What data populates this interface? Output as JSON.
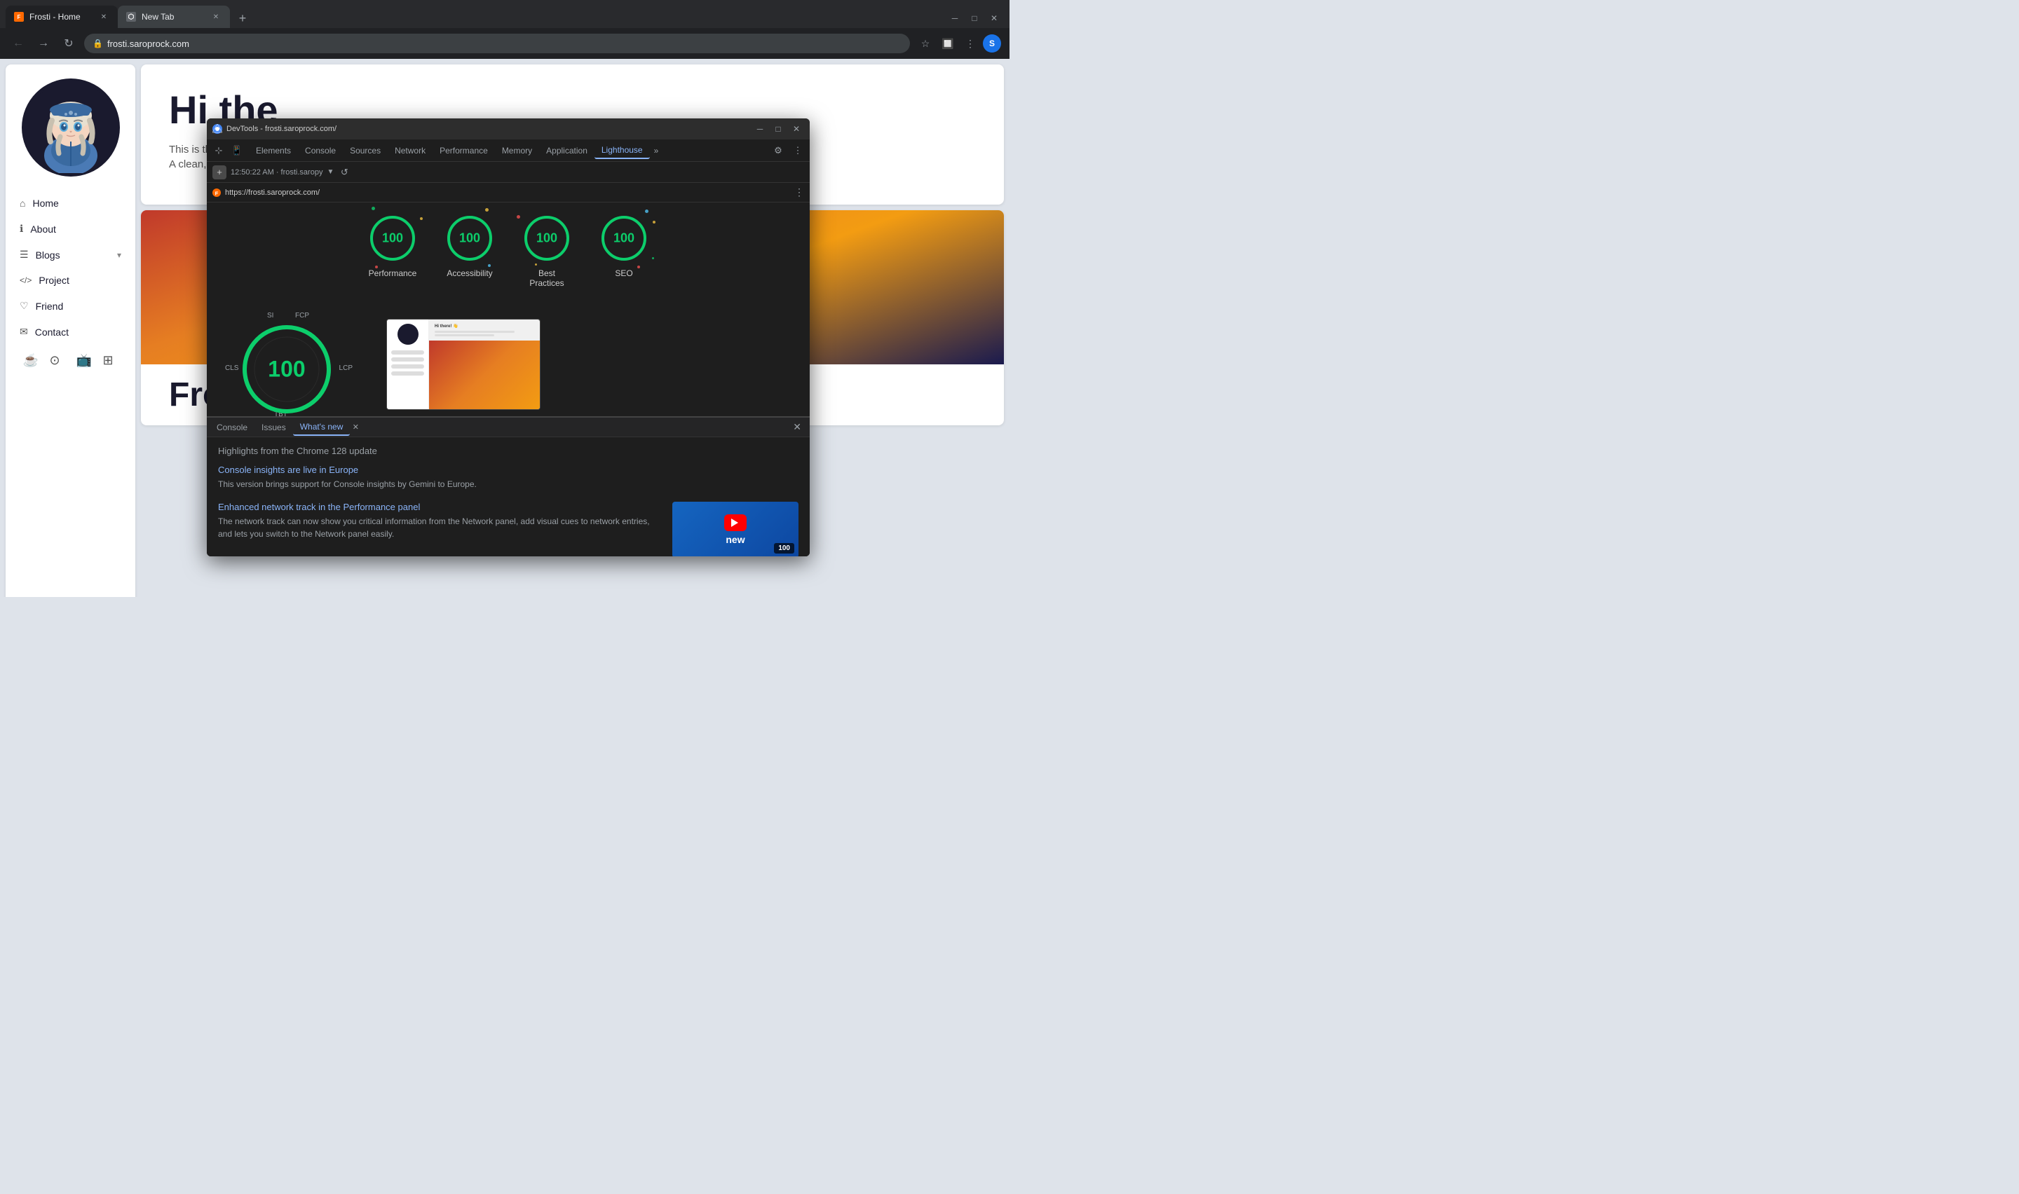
{
  "browser": {
    "tabs": [
      {
        "label": "Frosti - Home",
        "favicon": "F",
        "active": true
      },
      {
        "label": "New Tab",
        "favicon": "⬡",
        "active": false
      }
    ],
    "address": "frosti.saroprock.com",
    "window_title": "DevTools - frosti.saroprock.com/"
  },
  "sidebar": {
    "nav_items": [
      {
        "label": "Home",
        "icon": "○"
      },
      {
        "label": "About",
        "icon": "ℹ"
      },
      {
        "label": "Blogs",
        "icon": "☰",
        "expand": true
      },
      {
        "label": "Project",
        "icon": "</>"
      },
      {
        "label": "Friend",
        "icon": "♡"
      },
      {
        "label": "Contact",
        "icon": "✉"
      }
    ],
    "footer_icons": [
      "☕",
      "⊙",
      "📺",
      "⊞"
    ]
  },
  "hero": {
    "title": "Hi the",
    "subtitle1": "This is the Fros",
    "subtitle2": "A clean, elegan"
  },
  "intro": {
    "title": "Frosti Introduction"
  },
  "devtools": {
    "title": "DevTools - frosti.saroprock.com/",
    "tabs": [
      "Elements",
      "Console",
      "Sources",
      "Network",
      "Performance",
      "Memory",
      "Application",
      "Lighthouse"
    ],
    "active_tab": "Lighthouse",
    "timestamp": "12:50:22 AM · frosti.saropy",
    "page_url": "https://frosti.saroprock.com/",
    "scores": [
      {
        "label": "Performance",
        "value": "100"
      },
      {
        "label": "Accessibility",
        "value": "100"
      },
      {
        "label": "Best Practices",
        "value": "100"
      },
      {
        "label": "SEO",
        "value": "100"
      }
    ],
    "perf_score": "100",
    "perf_metrics": [
      "SI",
      "FCP",
      "CLS",
      "LCP",
      "TBT"
    ],
    "bottom_panel": {
      "tabs": [
        "Console",
        "Issues",
        "What's new"
      ],
      "active": "What's new",
      "highlights_title": "Highlights from the Chrome 128 update",
      "news": [
        {
          "title": "Console insights are live in Europe",
          "desc": "This version brings support for Console insights by Gemini to Europe."
        },
        {
          "title": "Enhanced network track in the Performance panel",
          "desc": "The network track can now show you critical information from the Network panel, add visual cues to network entries, and lets you switch to the Network panel easily."
        }
      ]
    }
  }
}
